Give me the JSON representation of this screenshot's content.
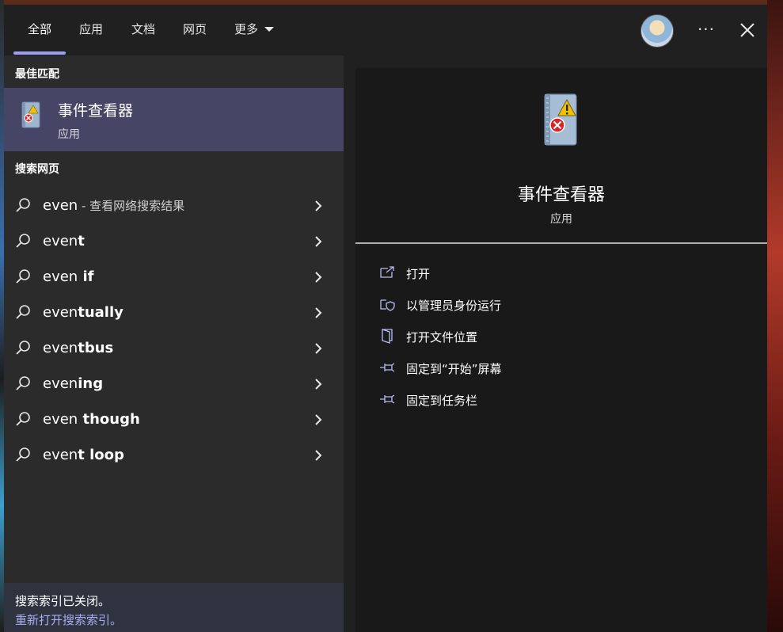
{
  "header": {
    "tabs": [
      {
        "label": "全部",
        "active": true
      },
      {
        "label": "应用"
      },
      {
        "label": "文档"
      },
      {
        "label": "网页"
      },
      {
        "label": "更多"
      }
    ]
  },
  "best_match": {
    "section_title": "最佳匹配",
    "title": "事件查看器",
    "subtitle": "应用",
    "icon": "event-viewer-icon"
  },
  "web_search": {
    "section_title": "搜索网页",
    "items": [
      {
        "typed": "even",
        "rest": "",
        "suffix": " - 查看网络搜索结果"
      },
      {
        "typed": "even",
        "rest": "t",
        "suffix": ""
      },
      {
        "typed": "even",
        "rest": " if",
        "suffix": ""
      },
      {
        "typed": "even",
        "rest": "tually",
        "suffix": ""
      },
      {
        "typed": "even",
        "rest": "tbus",
        "suffix": ""
      },
      {
        "typed": "even",
        "rest": "ing",
        "suffix": ""
      },
      {
        "typed": "even",
        "rest": " though",
        "suffix": ""
      },
      {
        "typed": "even",
        "rest": "t loop",
        "suffix": ""
      }
    ]
  },
  "footer": {
    "text": "搜索索引已关闭。",
    "link": "重新打开搜索索引。"
  },
  "preview": {
    "title": "事件查看器",
    "subtitle": "应用",
    "actions": [
      {
        "label": "打开",
        "icon": "open-icon"
      },
      {
        "label": "以管理员身份运行",
        "icon": "shield-icon"
      },
      {
        "label": "打开文件位置",
        "icon": "folder-icon"
      },
      {
        "label": "固定到“开始”屏幕",
        "icon": "pin-icon"
      },
      {
        "label": "固定到任务栏",
        "icon": "pin-icon"
      }
    ]
  },
  "colors": {
    "accent": "#9aa0f0",
    "selected_bg": "#474566",
    "left_bg": "#2b2b2b",
    "right_bg": "#191919"
  }
}
